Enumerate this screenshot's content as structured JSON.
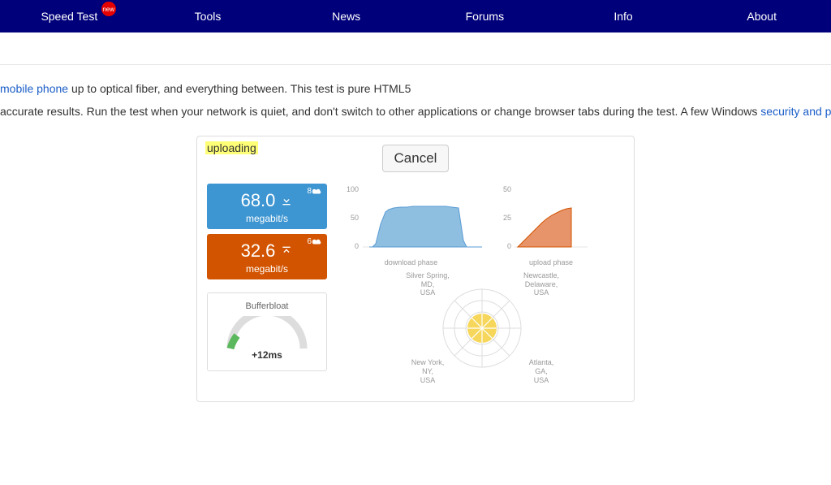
{
  "nav": {
    "items": [
      "Speed Test",
      "Tools",
      "News",
      "Forums",
      "Info",
      "About"
    ],
    "badge": "new"
  },
  "intro": {
    "line1_link": "mobile phone",
    "line1_rest": " up to optical fiber, and everything between. This test is pure HTML5",
    "line2_pre": " accurate results. Run the test when your network is quiet, and don't switch to other applications or change browser tabs during the test. A few Windows ",
    "line2_link": "security and privacy software package"
  },
  "test": {
    "status": "uploading",
    "cancel": "Cancel",
    "download": {
      "value": "68.0",
      "unit": "megabit/s",
      "streams": "8"
    },
    "upload": {
      "value": "32.6",
      "unit": "megabit/s",
      "streams": "6"
    },
    "bufferbloat": {
      "title": "Bufferbloat",
      "value": "+12ms"
    },
    "radar": {
      "tl": "Silver Spring, MD, USA",
      "tr": "Newcastle, Delaware, USA",
      "bl": "New York, NY, USA",
      "br": "Atlanta, GA, USA"
    }
  },
  "chart_data": [
    {
      "type": "area",
      "title": "download phase",
      "ylim": [
        0,
        100
      ],
      "yticks": [
        0,
        50,
        100
      ],
      "x": [
        0,
        1,
        2,
        3,
        4,
        5,
        6,
        7,
        8,
        9,
        10,
        11,
        12,
        13,
        14,
        15,
        16,
        17,
        18,
        19,
        20
      ],
      "values": [
        0,
        0,
        5,
        35,
        55,
        58,
        60,
        62,
        62,
        62,
        63,
        63,
        63,
        63,
        63,
        63,
        62,
        60,
        8,
        0,
        0
      ],
      "color": "#5a9bd4"
    },
    {
      "type": "area",
      "title": "upload phase",
      "ylim": [
        0,
        50
      ],
      "yticks": [
        0,
        25,
        50
      ],
      "x": [
        0,
        1,
        2,
        3,
        4,
        5,
        6,
        7,
        8,
        9,
        10,
        11,
        12
      ],
      "values": [
        0,
        4,
        8,
        12,
        16,
        20,
        24,
        27,
        29,
        30,
        31,
        32,
        33
      ],
      "color": "#d35400"
    }
  ]
}
